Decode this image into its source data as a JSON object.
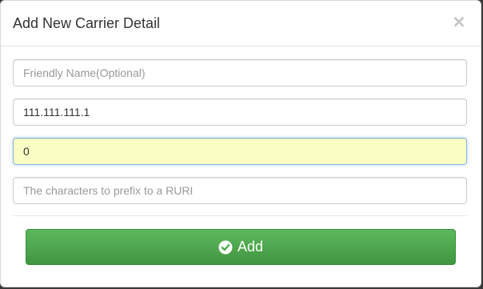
{
  "modal": {
    "title": "Add New Carrier Detail",
    "close_symbol": "×"
  },
  "form": {
    "fields": [
      {
        "placeholder": "Friendly Name(Optional)",
        "value": ""
      },
      {
        "placeholder": "",
        "value": "111.111.111.1"
      },
      {
        "placeholder": "",
        "value": "0"
      },
      {
        "placeholder": "The characters to prefix to a RURI",
        "value": ""
      }
    ],
    "submit_label": "Add",
    "submit_icon": "check-circle-icon"
  },
  "colors": {
    "focused_field_bg": "#fafdc4",
    "button_green": "#5cb85c"
  }
}
